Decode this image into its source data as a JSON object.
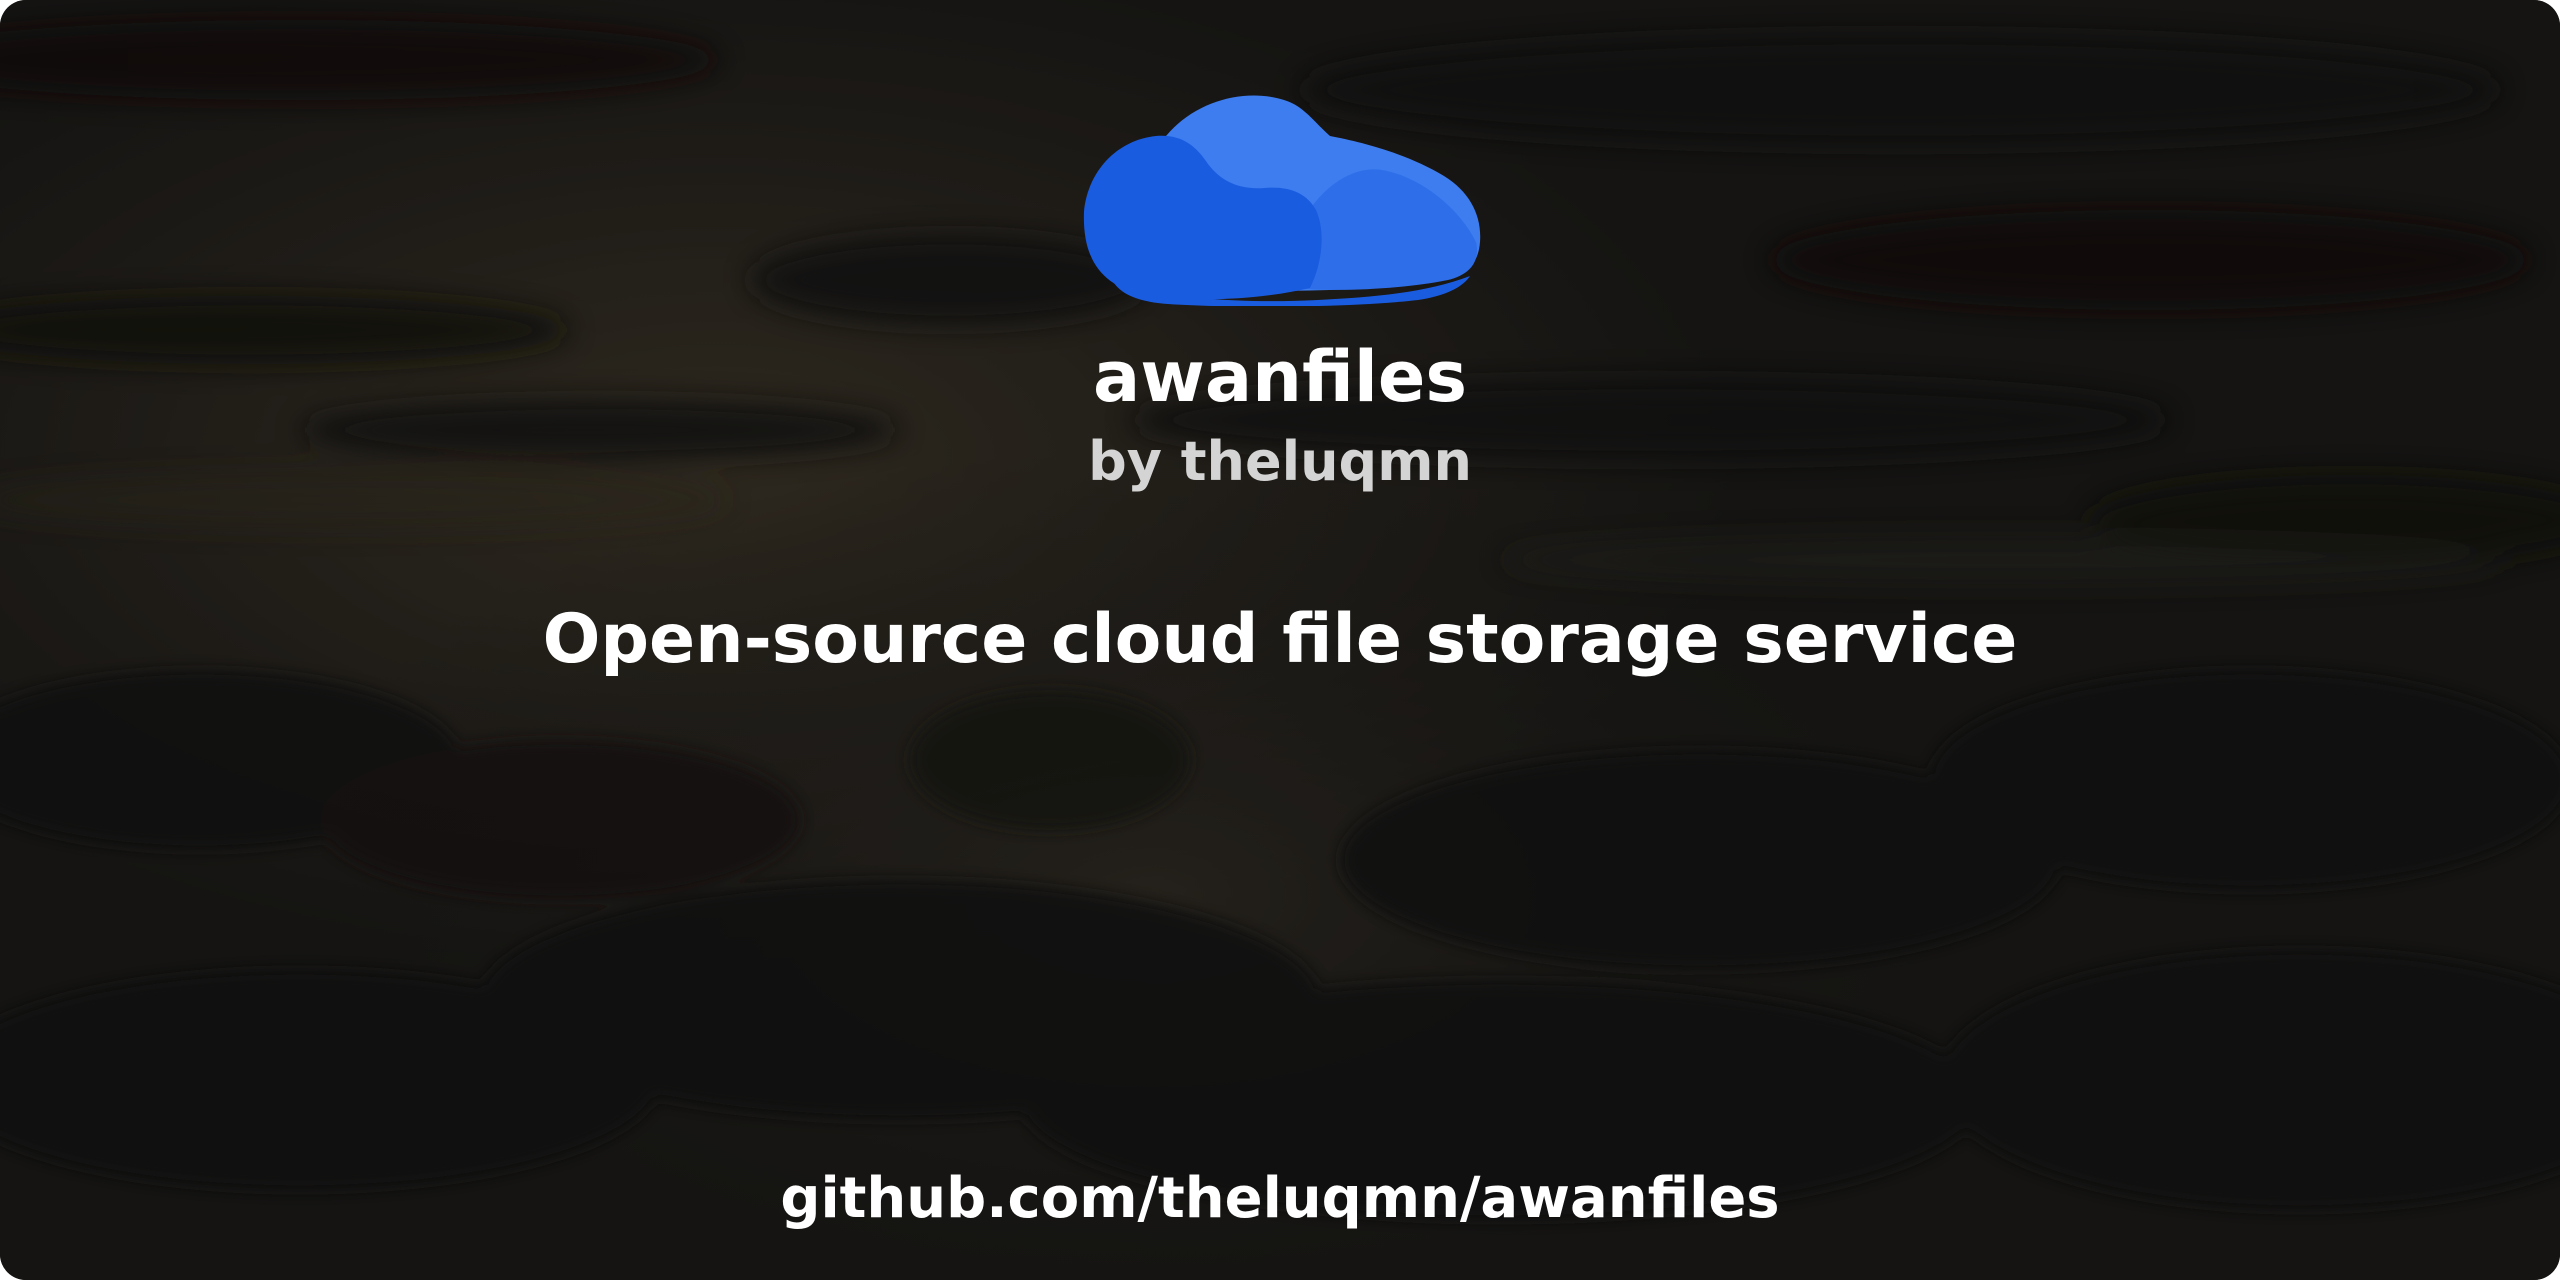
{
  "brand": {
    "name": "awanfiles",
    "byline": "by theluqmn",
    "logo_icon": "cloud-icon",
    "logo_colors": [
      "#1a5ce0",
      "#2e6ee8",
      "#3d7df0"
    ]
  },
  "tagline": "Open-source cloud file storage service",
  "repo_url": "github.com/theluqmn/awanfiles",
  "background": {
    "description_colors": [
      "#1b1a18",
      "#2b2824",
      "#3a342b"
    ]
  }
}
